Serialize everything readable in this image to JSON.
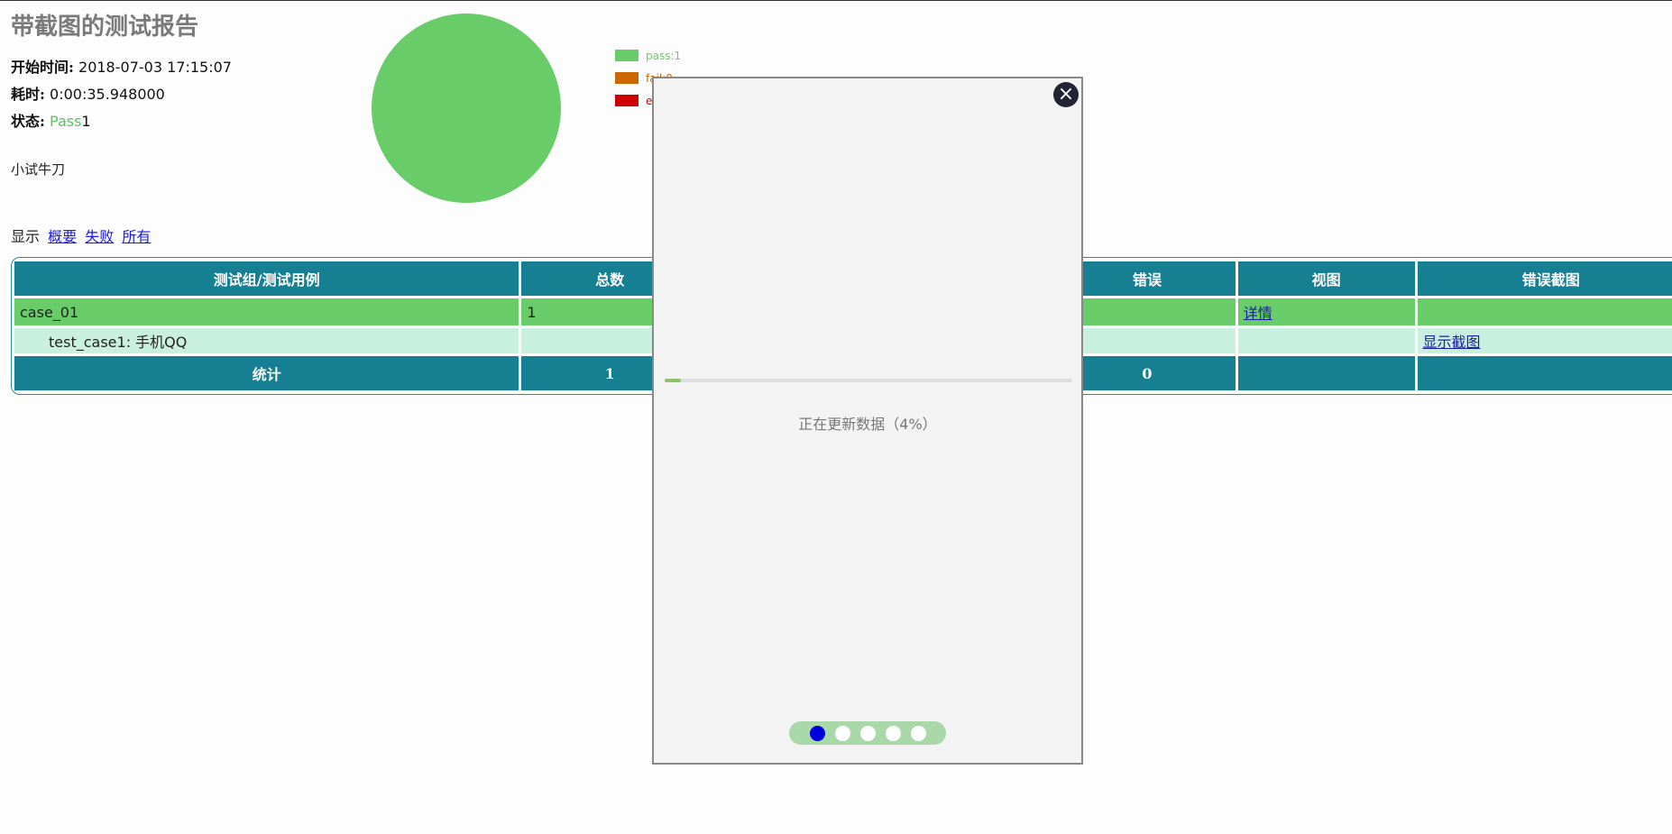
{
  "report": {
    "title": "带截图的测试报告",
    "start_label": "开始时间:",
    "start_value": "2018-07-03 17:15:07",
    "duration_label": "耗时:",
    "duration_value": "0:00:35.948000",
    "status_label": "状态:",
    "status_pass": "Pass",
    "status_count": "1",
    "description": "小试牛刀"
  },
  "chart_data": {
    "type": "pie",
    "values": [
      1,
      0,
      0
    ],
    "legend": [
      "pass:1",
      "fail:0",
      "e"
    ],
    "colors": [
      "#68cc68",
      "#cc6600",
      "#cc0000"
    ]
  },
  "filter": {
    "label": "显示",
    "links": [
      "概要",
      "失败",
      "所有"
    ]
  },
  "table": {
    "headers": [
      "测试组/测试用例",
      "总数",
      "错误",
      "视图",
      "错误截图"
    ],
    "group_row": {
      "name": "case_01",
      "total": "1",
      "detail": "详情"
    },
    "case_row": {
      "name": "test_case1: 手机QQ",
      "screenshot": "显示截图"
    },
    "total_row": {
      "label": "统计",
      "total": "1",
      "error": "0"
    }
  },
  "modal": {
    "close_symbol": "×",
    "progress_percent": 4,
    "progress_text": "正在更新数据（4%）",
    "dots": 5,
    "active_dot": 0
  }
}
